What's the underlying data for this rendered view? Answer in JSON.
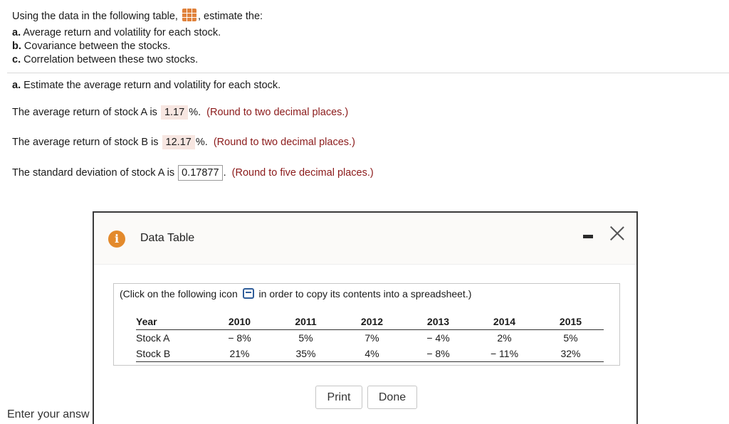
{
  "question": {
    "intro_before": "Using the data in the following table,",
    "intro_after": ", estimate the:",
    "parts": [
      {
        "label": "a.",
        "text": "Average return and volatility for each stock."
      },
      {
        "label": "b.",
        "text": "Covariance between the stocks."
      },
      {
        "label": "c.",
        "text": "Correlation between these two stocks."
      }
    ]
  },
  "answer_section": {
    "heading_label": "a.",
    "heading_text": "Estimate the average return and volatility for each stock.",
    "line1": {
      "prefix": "The average return of stock A is",
      "value": "1.17",
      "suffix": "%.",
      "hint": "(Round to two decimal places.)"
    },
    "line2": {
      "prefix": "The average return of stock B is",
      "value": "12.17",
      "suffix": "%.",
      "hint": "(Round to two decimal places.)"
    },
    "line3": {
      "prefix": "The standard deviation of stock A is",
      "value": "0.17877",
      "suffix": ".",
      "hint": "(Round to five decimal places.)"
    }
  },
  "modal": {
    "title": "Data Table",
    "copy_note_before": "(Click on the following icon",
    "copy_note_after": "in order to copy its contents into a spreadsheet.)",
    "table": {
      "header": [
        "Year",
        "2010",
        "2011",
        "2012",
        "2013",
        "2014",
        "2015"
      ],
      "rows": [
        [
          "Stock A",
          "− 8%",
          "5%",
          "7%",
          "− 4%",
          "2%",
          "5%"
        ],
        [
          "Stock B",
          "21%",
          "35%",
          "4%",
          "− 8%",
          "− 11%",
          "32%"
        ]
      ]
    },
    "print_label": "Print",
    "done_label": "Done"
  },
  "footer": {
    "enter_answer": "Enter your answ"
  },
  "icons": {
    "table": "table-grid-icon",
    "info": "info-icon",
    "copy": "copy-icon",
    "minimize": "minimize-icon",
    "close": "close-icon"
  },
  "colors": {
    "accent_orange": "#e0823c",
    "hint_red": "#8b1a1a",
    "answer_bg": "#f7e6e1",
    "copy_blue": "#2f5d9a"
  }
}
